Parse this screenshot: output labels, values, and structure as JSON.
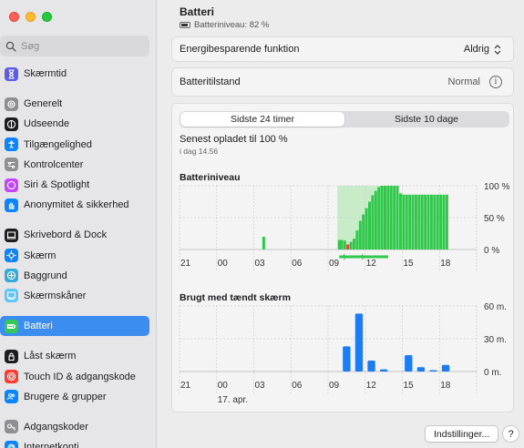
{
  "sidebar": {
    "search_placeholder": "Søg",
    "items": [
      {
        "label": "Skærmtid",
        "icon": "hourglass-icon",
        "color": "#5e5ce6"
      },
      {
        "label": "Generelt",
        "icon": "gear-icon",
        "color": "#8e8e93"
      },
      {
        "label": "Udseende",
        "icon": "appearance-icon",
        "color": "#1d1d1f"
      },
      {
        "label": "Tilgængelighed",
        "icon": "accessibility-icon",
        "color": "#0a84ff"
      },
      {
        "label": "Kontrolcenter",
        "icon": "control-center-icon",
        "color": "#8e8e93"
      },
      {
        "label": "Siri & Spotlight",
        "icon": "siri-icon",
        "color": "#c644fc"
      },
      {
        "label": "Anonymitet & sikkerhed",
        "icon": "hand-icon",
        "color": "#0a84ff"
      },
      {
        "label": "Skrivebord & Dock",
        "icon": "dock-icon",
        "color": "#1d1d1f"
      },
      {
        "label": "Skærm",
        "icon": "display-icon",
        "color": "#0a84ff"
      },
      {
        "label": "Baggrund",
        "icon": "wallpaper-icon",
        "color": "#34aadc"
      },
      {
        "label": "Skærmskåner",
        "icon": "screensaver-icon",
        "color": "#5ac8fa"
      },
      {
        "label": "Batteri",
        "icon": "battery-icon",
        "color": "#34c759"
      },
      {
        "label": "Låst skærm",
        "icon": "lock-icon",
        "color": "#1d1d1f"
      },
      {
        "label": "Touch ID & adgangskode",
        "icon": "fingerprint-icon",
        "color": "#ff3b30"
      },
      {
        "label": "Brugere & grupper",
        "icon": "users-icon",
        "color": "#0a84ff"
      },
      {
        "label": "Adgangskoder",
        "icon": "key-icon",
        "color": "#8e8e93"
      },
      {
        "label": "Internetkonti",
        "icon": "at-icon",
        "color": "#0a84ff"
      }
    ],
    "active": "Batteri"
  },
  "header": {
    "title": "Batteri",
    "subtitle": "Batteriniveau: 82 %"
  },
  "settings": {
    "energy_label": "Energibesparende funktion",
    "energy_value": "Aldrig",
    "health_label": "Batteritilstand",
    "health_value": "Normal"
  },
  "tabs": {
    "tab_24h": "Sidste 24 timer",
    "tab_10d": "Sidste 10 dage",
    "selected": "Sidste 24 timer"
  },
  "last_charged": {
    "text": "Senest opladet til 100 %",
    "time": "i dag 14.56"
  },
  "colors": {
    "battery_green": "#30c84a",
    "charging_band": "#c8ecc8",
    "low_red": "#e0443e",
    "usage_blue": "#1c7cf2",
    "accent": "#3b8ef0"
  },
  "chart_data": [
    {
      "type": "bar",
      "title": "Batteriniveau",
      "x_tick_labels": [
        "21",
        "00",
        "03",
        "06",
        "09",
        "12",
        "15",
        "18"
      ],
      "y_tick_labels": [
        "100 %",
        "50 %",
        "0 %"
      ],
      "ylim": [
        0,
        100
      ],
      "unit": "%",
      "charging_hours": [
        9.75,
        14.0
      ],
      "values": [
        {
          "hour": 3.8,
          "value": 20
        },
        {
          "hour": 9.9,
          "value": 15
        },
        {
          "hour": 10.1,
          "value": 15
        },
        {
          "hour": 10.35,
          "value": 14
        },
        {
          "hour": 10.6,
          "value": 8,
          "low": true
        },
        {
          "hour": 10.85,
          "value": 12
        },
        {
          "hour": 11.1,
          "value": 17
        },
        {
          "hour": 11.35,
          "value": 30
        },
        {
          "hour": 11.6,
          "value": 45
        },
        {
          "hour": 11.85,
          "value": 55
        },
        {
          "hour": 12.1,
          "value": 65
        },
        {
          "hour": 12.35,
          "value": 75
        },
        {
          "hour": 12.6,
          "value": 85
        },
        {
          "hour": 12.85,
          "value": 92
        },
        {
          "hour": 13.1,
          "value": 98
        },
        {
          "hour": 13.35,
          "value": 100
        },
        {
          "hour": 13.6,
          "value": 100
        },
        {
          "hour": 13.85,
          "value": 100
        },
        {
          "hour": 14.1,
          "value": 100
        },
        {
          "hour": 14.35,
          "value": 100
        },
        {
          "hour": 14.6,
          "value": 100
        },
        {
          "hour": 14.85,
          "value": 88
        },
        {
          "hour": 15.1,
          "value": 86
        },
        {
          "hour": 15.35,
          "value": 86
        },
        {
          "hour": 15.6,
          "value": 86
        },
        {
          "hour": 15.85,
          "value": 86
        },
        {
          "hour": 16.1,
          "value": 86
        },
        {
          "hour": 16.35,
          "value": 86
        },
        {
          "hour": 16.6,
          "value": 86
        },
        {
          "hour": 16.85,
          "value": 86
        },
        {
          "hour": 17.1,
          "value": 86
        },
        {
          "hour": 17.35,
          "value": 86
        },
        {
          "hour": 17.6,
          "value": 86
        },
        {
          "hour": 17.85,
          "value": 86
        },
        {
          "hour": 18.1,
          "value": 86
        },
        {
          "hour": 18.35,
          "value": 86
        },
        {
          "hour": 18.6,
          "value": 86
        }
      ]
    },
    {
      "type": "bar",
      "title": "Brugt med tændt skærm",
      "x_tick_labels": [
        "21",
        "00",
        "03",
        "06",
        "09",
        "12",
        "15",
        "18"
      ],
      "date_label": "17. apr.",
      "y_tick_labels": [
        "60 m.",
        "30 m.",
        "0 m."
      ],
      "ylim": [
        0,
        60
      ],
      "unit": "min",
      "values": [
        {
          "hour": 10.5,
          "value": 23
        },
        {
          "hour": 11.5,
          "value": 53
        },
        {
          "hour": 12.5,
          "value": 10
        },
        {
          "hour": 13.5,
          "value": 2
        },
        {
          "hour": 15.5,
          "value": 15
        },
        {
          "hour": 16.5,
          "value": 4
        },
        {
          "hour": 17.5,
          "value": 1
        },
        {
          "hour": 18.5,
          "value": 6
        }
      ]
    }
  ],
  "footer": {
    "settings_button": "Indstillinger...",
    "help_button": "?"
  }
}
